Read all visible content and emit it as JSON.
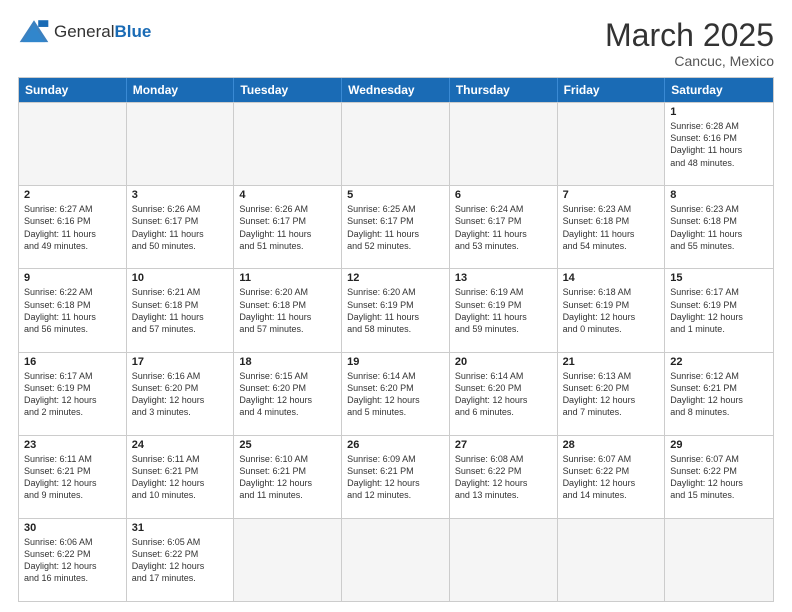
{
  "header": {
    "logo_general": "General",
    "logo_blue": "Blue",
    "title": "March 2025",
    "subtitle": "Cancuc, Mexico"
  },
  "days": [
    "Sunday",
    "Monday",
    "Tuesday",
    "Wednesday",
    "Thursday",
    "Friday",
    "Saturday"
  ],
  "weeks": [
    [
      {
        "num": "",
        "text": "",
        "empty": true
      },
      {
        "num": "",
        "text": "",
        "empty": true
      },
      {
        "num": "",
        "text": "",
        "empty": true
      },
      {
        "num": "",
        "text": "",
        "empty": true
      },
      {
        "num": "",
        "text": "",
        "empty": true
      },
      {
        "num": "",
        "text": "",
        "empty": true
      },
      {
        "num": "1",
        "text": "Sunrise: 6:28 AM\nSunset: 6:16 PM\nDaylight: 11 hours\nand 48 minutes."
      }
    ],
    [
      {
        "num": "2",
        "text": "Sunrise: 6:27 AM\nSunset: 6:16 PM\nDaylight: 11 hours\nand 49 minutes."
      },
      {
        "num": "3",
        "text": "Sunrise: 6:26 AM\nSunset: 6:17 PM\nDaylight: 11 hours\nand 50 minutes."
      },
      {
        "num": "4",
        "text": "Sunrise: 6:26 AM\nSunset: 6:17 PM\nDaylight: 11 hours\nand 51 minutes."
      },
      {
        "num": "5",
        "text": "Sunrise: 6:25 AM\nSunset: 6:17 PM\nDaylight: 11 hours\nand 52 minutes."
      },
      {
        "num": "6",
        "text": "Sunrise: 6:24 AM\nSunset: 6:17 PM\nDaylight: 11 hours\nand 53 minutes."
      },
      {
        "num": "7",
        "text": "Sunrise: 6:23 AM\nSunset: 6:18 PM\nDaylight: 11 hours\nand 54 minutes."
      },
      {
        "num": "8",
        "text": "Sunrise: 6:23 AM\nSunset: 6:18 PM\nDaylight: 11 hours\nand 55 minutes."
      }
    ],
    [
      {
        "num": "9",
        "text": "Sunrise: 6:22 AM\nSunset: 6:18 PM\nDaylight: 11 hours\nand 56 minutes."
      },
      {
        "num": "10",
        "text": "Sunrise: 6:21 AM\nSunset: 6:18 PM\nDaylight: 11 hours\nand 57 minutes."
      },
      {
        "num": "11",
        "text": "Sunrise: 6:20 AM\nSunset: 6:18 PM\nDaylight: 11 hours\nand 57 minutes."
      },
      {
        "num": "12",
        "text": "Sunrise: 6:20 AM\nSunset: 6:19 PM\nDaylight: 11 hours\nand 58 minutes."
      },
      {
        "num": "13",
        "text": "Sunrise: 6:19 AM\nSunset: 6:19 PM\nDaylight: 11 hours\nand 59 minutes."
      },
      {
        "num": "14",
        "text": "Sunrise: 6:18 AM\nSunset: 6:19 PM\nDaylight: 12 hours\nand 0 minutes."
      },
      {
        "num": "15",
        "text": "Sunrise: 6:17 AM\nSunset: 6:19 PM\nDaylight: 12 hours\nand 1 minute."
      }
    ],
    [
      {
        "num": "16",
        "text": "Sunrise: 6:17 AM\nSunset: 6:19 PM\nDaylight: 12 hours\nand 2 minutes."
      },
      {
        "num": "17",
        "text": "Sunrise: 6:16 AM\nSunset: 6:20 PM\nDaylight: 12 hours\nand 3 minutes."
      },
      {
        "num": "18",
        "text": "Sunrise: 6:15 AM\nSunset: 6:20 PM\nDaylight: 12 hours\nand 4 minutes."
      },
      {
        "num": "19",
        "text": "Sunrise: 6:14 AM\nSunset: 6:20 PM\nDaylight: 12 hours\nand 5 minutes."
      },
      {
        "num": "20",
        "text": "Sunrise: 6:14 AM\nSunset: 6:20 PM\nDaylight: 12 hours\nand 6 minutes."
      },
      {
        "num": "21",
        "text": "Sunrise: 6:13 AM\nSunset: 6:20 PM\nDaylight: 12 hours\nand 7 minutes."
      },
      {
        "num": "22",
        "text": "Sunrise: 6:12 AM\nSunset: 6:21 PM\nDaylight: 12 hours\nand 8 minutes."
      }
    ],
    [
      {
        "num": "23",
        "text": "Sunrise: 6:11 AM\nSunset: 6:21 PM\nDaylight: 12 hours\nand 9 minutes."
      },
      {
        "num": "24",
        "text": "Sunrise: 6:11 AM\nSunset: 6:21 PM\nDaylight: 12 hours\nand 10 minutes."
      },
      {
        "num": "25",
        "text": "Sunrise: 6:10 AM\nSunset: 6:21 PM\nDaylight: 12 hours\nand 11 minutes."
      },
      {
        "num": "26",
        "text": "Sunrise: 6:09 AM\nSunset: 6:21 PM\nDaylight: 12 hours\nand 12 minutes."
      },
      {
        "num": "27",
        "text": "Sunrise: 6:08 AM\nSunset: 6:22 PM\nDaylight: 12 hours\nand 13 minutes."
      },
      {
        "num": "28",
        "text": "Sunrise: 6:07 AM\nSunset: 6:22 PM\nDaylight: 12 hours\nand 14 minutes."
      },
      {
        "num": "29",
        "text": "Sunrise: 6:07 AM\nSunset: 6:22 PM\nDaylight: 12 hours\nand 15 minutes."
      }
    ],
    [
      {
        "num": "30",
        "text": "Sunrise: 6:06 AM\nSunset: 6:22 PM\nDaylight: 12 hours\nand 16 minutes."
      },
      {
        "num": "31",
        "text": "Sunrise: 6:05 AM\nSunset: 6:22 PM\nDaylight: 12 hours\nand 17 minutes."
      },
      {
        "num": "",
        "text": "",
        "empty": true
      },
      {
        "num": "",
        "text": "",
        "empty": true
      },
      {
        "num": "",
        "text": "",
        "empty": true
      },
      {
        "num": "",
        "text": "",
        "empty": true
      },
      {
        "num": "",
        "text": "",
        "empty": true
      }
    ]
  ]
}
